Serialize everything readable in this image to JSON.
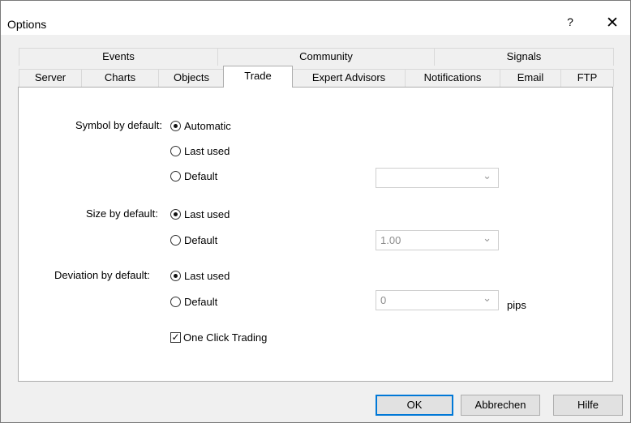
{
  "window": {
    "title": "Options",
    "help_label": "?",
    "close_label": "✕"
  },
  "tabs": {
    "row1": [
      {
        "label": "Events"
      },
      {
        "label": "Community"
      },
      {
        "label": "Signals"
      }
    ],
    "row2": [
      {
        "label": "Server"
      },
      {
        "label": "Charts"
      },
      {
        "label": "Objects"
      },
      {
        "label": "Trade",
        "active": true
      },
      {
        "label": "Expert Advisors"
      },
      {
        "label": "Notifications"
      },
      {
        "label": "Email"
      },
      {
        "label": "FTP"
      }
    ]
  },
  "trade": {
    "symbol": {
      "label": "Symbol by default:",
      "options": [
        "Automatic",
        "Last used",
        "Default"
      ],
      "selected": "Automatic",
      "combo_value": ""
    },
    "size": {
      "label": "Size by default:",
      "options": [
        "Last used",
        "Default"
      ],
      "selected": "Last used",
      "combo_value": "1.00"
    },
    "deviation": {
      "label": "Deviation by default:",
      "options": [
        "Last used",
        "Default"
      ],
      "selected": "Last used",
      "combo_value": "0",
      "unit": "pips"
    },
    "one_click": {
      "label": "One Click Trading",
      "checked": true
    }
  },
  "buttons": {
    "ok": "OK",
    "cancel": "Abbrechen",
    "help": "Hilfe"
  },
  "colors": {
    "accent": "#0078d7",
    "dialog_bg": "#f0f0f0",
    "panel_bg": "#ffffff"
  }
}
